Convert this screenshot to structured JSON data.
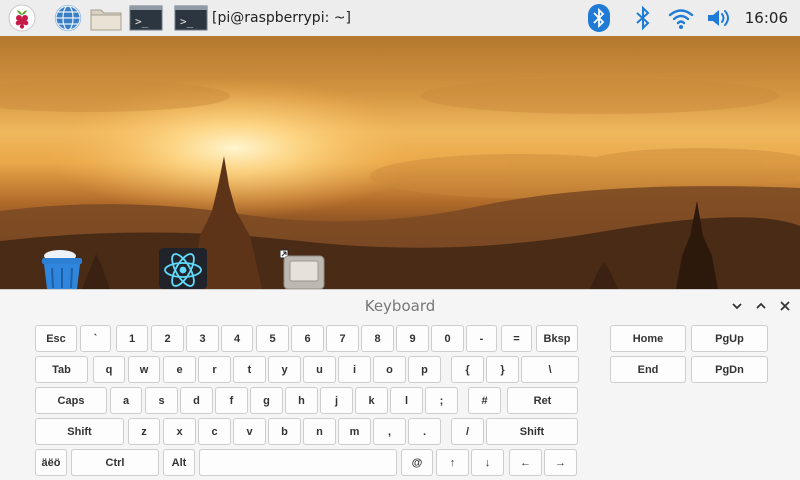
{
  "taskbar": {
    "terminal_task_label": "[pi@raspberrypi: ~]",
    "clock": "16:06",
    "icons": [
      "raspberry-menu-icon",
      "web-browser-icon",
      "file-manager-icon",
      "terminal-launcher-icon",
      "bluetooth-icon",
      "bluetooth-status-icon",
      "wifi-icon",
      "volume-icon"
    ]
  },
  "desktop": {
    "icons": [
      "trash-icon",
      "react-app-icon",
      "disk-drive-icon"
    ]
  },
  "keyboard": {
    "title": "Keyboard",
    "rows": [
      [
        "Esc",
        "`",
        "1",
        "2",
        "3",
        "4",
        "5",
        "6",
        "7",
        "8",
        "9",
        "0",
        "-",
        "=",
        "Bksp"
      ],
      [
        "Tab",
        "q",
        "w",
        "e",
        "r",
        "t",
        "y",
        "u",
        "i",
        "o",
        "p",
        "{",
        "}",
        "\\"
      ],
      [
        "Caps",
        "a",
        "s",
        "d",
        "f",
        "g",
        "h",
        "j",
        "k",
        "l",
        ";",
        "#",
        "Ret"
      ],
      [
        "Shift",
        "z",
        "x",
        "c",
        "v",
        "b",
        "n",
        "m",
        ",",
        ".",
        "/",
        "Shift"
      ],
      [
        "äëö",
        "Ctrl",
        "Alt",
        "",
        "@",
        "↑",
        "↓",
        "←",
        "→"
      ]
    ],
    "nav_rows": [
      [
        "Home",
        "PgUp"
      ],
      [
        "End",
        "PgDn"
      ]
    ]
  },
  "colors": {
    "panel_bg": "#ededed",
    "keyboard_bg": "#f5f5f5",
    "key_bg": "#fdfdfd",
    "bluetooth_blue": "#1f7bd6"
  }
}
